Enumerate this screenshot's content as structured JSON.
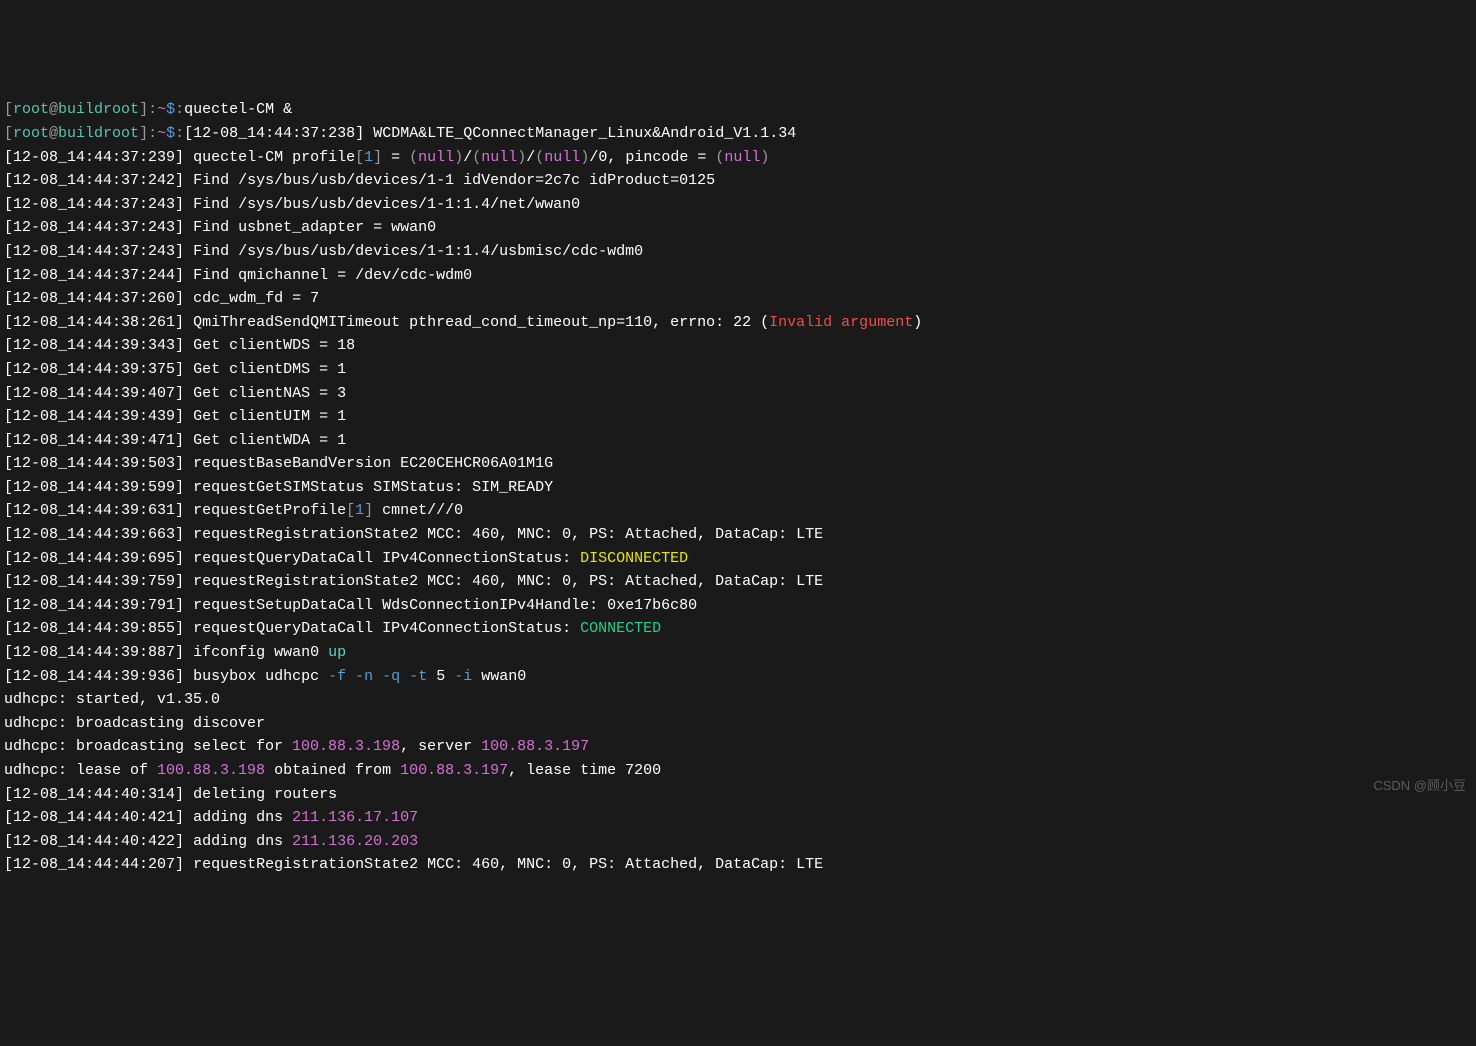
{
  "prompt1": {
    "user": "root",
    "at": "@",
    "host": "buildroot",
    "colon1": ":",
    "tilde": "~",
    "dollar": "$",
    "colon2": ":",
    "cmd": "quectel-CM &"
  },
  "prompt2": {
    "user": "root",
    "at": "@",
    "host": "buildroot",
    "colon1": ":",
    "tilde": "~",
    "dollar": "$",
    "colon2": ":"
  },
  "l0": {
    "lb": "[",
    "ts": "12-08_14:44:37:238",
    "rb": "]",
    "txt": " WCDMA&LTE_QConnectManager_Linux&Android_V1.1.34"
  },
  "l1": {
    "lb": "[",
    "ts": "12-08_14:44:37:239",
    "rb": "]",
    "pre": " quectel-CM profile",
    "lb2": "[",
    "one": "1",
    "rb2": "]",
    "eq": " = ",
    "lp": "(",
    "n1": "null",
    "rp": ")",
    "sl1": "/",
    "lp2": "(",
    "n2": "null",
    "rp2": ")",
    "sl2": "/",
    "lp3": "(",
    "n3": "null",
    "rp3": ")",
    "sl3": "/",
    "zero": "0",
    ", pincode = ": " , pincode = ",
    "pin": ", pincode = ",
    "lp4": "(",
    "n4": "null",
    "rp4": ")"
  },
  "l2": {
    "lb": "[",
    "ts": "12-08_14:44:37:242",
    "rb": "]",
    "txt": " Find /sys/bus/usb/devices/1-1 idVendor=2c7c idProduct=0125"
  },
  "l3": {
    "lb": "[",
    "ts": "12-08_14:44:37:243",
    "rb": "]",
    "txt": " Find /sys/bus/usb/devices/1-1:1.4/net/wwan0"
  },
  "l4": {
    "lb": "[",
    "ts": "12-08_14:44:37:243",
    "rb": "]",
    "txt": " Find usbnet_adapter = wwan0"
  },
  "l5": {
    "lb": "[",
    "ts": "12-08_14:44:37:243",
    "rb": "]",
    "txt": " Find /sys/bus/usb/devices/1-1:1.4/usbmisc/cdc-wdm0"
  },
  "l6": {
    "lb": "[",
    "ts": "12-08_14:44:37:244",
    "rb": "]",
    "txt": " Find qmichannel = /dev/cdc-wdm0"
  },
  "l7": {
    "lb": "[",
    "ts": "12-08_14:44:37:260",
    "rb": "]",
    "txt": " cdc_wdm_fd = 7"
  },
  "l8": {
    "lb": "[",
    "ts": "12-08_14:44:38:261",
    "rb": "]",
    "pre": " QmiThreadSendQMITimeout pthread_cond_timeout_np=110, errno: 22 (",
    "err": "Invalid argument",
    "post": ")"
  },
  "l9": {
    "lb": "[",
    "ts": "12-08_14:44:39:343",
    "rb": "]",
    "txt": " Get clientWDS = 18"
  },
  "l10": {
    "lb": "[",
    "ts": "12-08_14:44:39:375",
    "rb": "]",
    "txt": " Get clientDMS = 1"
  },
  "l11": {
    "lb": "[",
    "ts": "12-08_14:44:39:407",
    "rb": "]",
    "txt": " Get clientNAS = 3"
  },
  "l12": {
    "lb": "[",
    "ts": "12-08_14:44:39:439",
    "rb": "]",
    "txt": " Get clientUIM = 1"
  },
  "l13": {
    "lb": "[",
    "ts": "12-08_14:44:39:471",
    "rb": "]",
    "txt": " Get clientWDA = 1"
  },
  "l14": {
    "lb": "[",
    "ts": "12-08_14:44:39:503",
    "rb": "]",
    "txt": " requestBaseBandVersion EC20CEHCR06A01M1G"
  },
  "l15": {
    "lb": "[",
    "ts": "12-08_14:44:39:599",
    "rb": "]",
    "txt": " requestGetSIMStatus SIMStatus: SIM_READY"
  },
  "l16": {
    "lb": "[",
    "ts": "12-08_14:44:39:631",
    "rb": "]",
    "pre": " requestGetProfile",
    "lb2": "[",
    "one": "1",
    "rb2": "]",
    "txt": " cmnet///0"
  },
  "l17": {
    "lb": "[",
    "ts": "12-08_14:44:39:663",
    "rb": "]",
    "txt": " requestRegistrationState2 MCC: 460, MNC: 0, PS: Attached, DataCap: LTE"
  },
  "l18": {
    "lb": "[",
    "ts": "12-08_14:44:39:695",
    "rb": "]",
    "pre": " requestQueryDataCall IPv4ConnectionStatus: ",
    "st": "DISCONNECTED"
  },
  "l19": {
    "lb": "[",
    "ts": "12-08_14:44:39:759",
    "rb": "]",
    "txt": " requestRegistrationState2 MCC: 460, MNC: 0, PS: Attached, DataCap: LTE"
  },
  "l20": {
    "lb": "[",
    "ts": "12-08_14:44:39:791",
    "rb": "]",
    "txt": " requestSetupDataCall WdsConnectionIPv4Handle: 0xe17b6c80"
  },
  "l21": {
    "lb": "[",
    "ts": "12-08_14:44:39:855",
    "rb": "]",
    "pre": " requestQueryDataCall IPv4ConnectionStatus: ",
    "st": "CONNECTED"
  },
  "l22": {
    "lb": "[",
    "ts": "12-08_14:44:39:887",
    "rb": "]",
    "pre": " ifconfig wwan0 ",
    "up": "up"
  },
  "l23": {
    "lb": "[",
    "ts": "12-08_14:44:39:936",
    "rb": "]",
    "pre": " busybox udhcpc ",
    "f": "-f",
    "sp1": " ",
    "n": "-n",
    "sp2": " ",
    "q": "-q",
    "sp3": " ",
    "t": "-t",
    "five": " 5 ",
    "i": "-i",
    "txt": " wwan0"
  },
  "u1": "udhcpc: started, v1.35.0",
  "u2": "udhcpc: broadcasting discover",
  "u3": {
    "pre": "udhcpc: broadcasting select for ",
    "ip1": "100.88.3.198",
    "mid": ", server ",
    "ip2": "100.88.3.197"
  },
  "u4": {
    "pre": "udhcpc: lease of ",
    "ip1": "100.88.3.198",
    "mid": " obtained from ",
    "ip2": "100.88.3.197",
    "post": ", lease time 7200"
  },
  "l24": {
    "lb": "[",
    "ts": "12-08_14:44:40:314",
    "rb": "]",
    "txt": " deleting routers"
  },
  "l25": {
    "lb": "[",
    "ts": "12-08_14:44:40:421",
    "rb": "]",
    "pre": " adding dns ",
    "ip": "211.136.17.107"
  },
  "l26": {
    "lb": "[",
    "ts": "12-08_14:44:40:422",
    "rb": "]",
    "pre": " adding dns ",
    "ip": "211.136.20.203"
  },
  "l27": {
    "lb": "[",
    "ts": "12-08_14:44:44:207",
    "rb": "]",
    "txt": " requestRegistrationState2 MCC: 460, MNC: 0, PS: Attached, DataCap: LTE"
  },
  "watermark": "CSDN @顾小豆"
}
